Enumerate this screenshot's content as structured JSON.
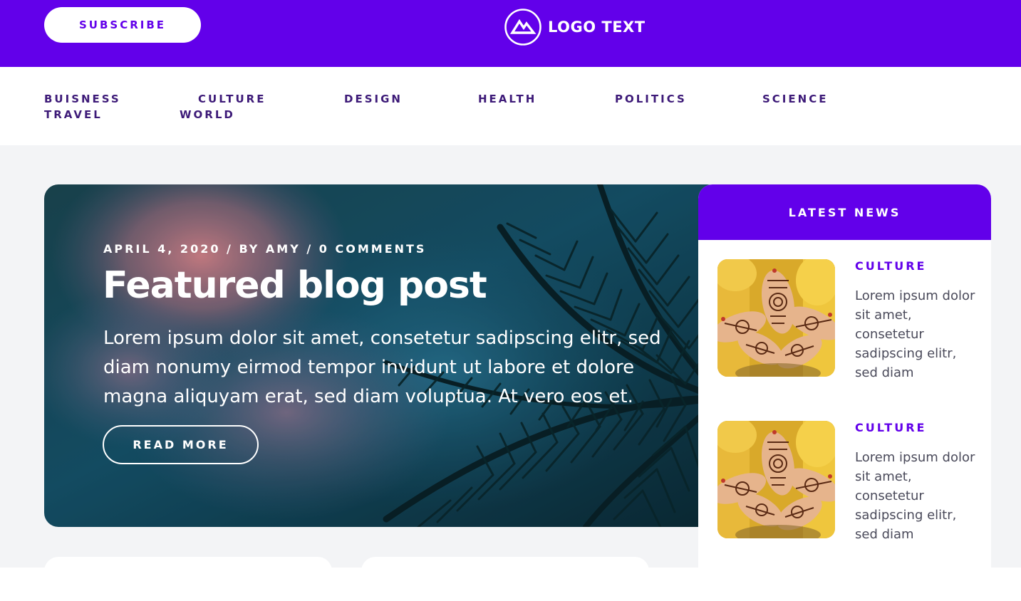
{
  "header": {
    "subscribe_label": "SUBSCRIBE",
    "logo_text": "LOGO TEXT",
    "brand_color": "#6200ea"
  },
  "nav": {
    "items": [
      "BUISNESS",
      "CULTURE",
      "DESIGN",
      "HEALTH",
      "POLITICS",
      "SCIENCE",
      "TRAVEL",
      "WORLD"
    ]
  },
  "hero": {
    "meta": "APRIL 4, 2020 / BY AMY / 0 COMMENTS",
    "title": "Featured blog post",
    "text": "Lorem ipsum dolor sit amet, consetetur sadipscing elitr, sed diam nonumy eirmod tempor invidunt ut labore et dolore magna aliquyam erat, sed diam voluptua. At vero eos et.",
    "button_label": "READ MORE",
    "image_icon": "palm-tree-sky-image"
  },
  "latest_news": {
    "title": "LATEST NEWS",
    "items": [
      {
        "category": "CULTURE",
        "text": "Lorem ipsum dolor sit amet, consetetur sadipscing elitr, sed diam",
        "image_icon": "henna-hands-image"
      },
      {
        "category": "CULTURE",
        "text": "Lorem ipsum dolor sit amet, consetetur sadipscing elitr, sed diam",
        "image_icon": "henna-hands-image"
      }
    ]
  }
}
